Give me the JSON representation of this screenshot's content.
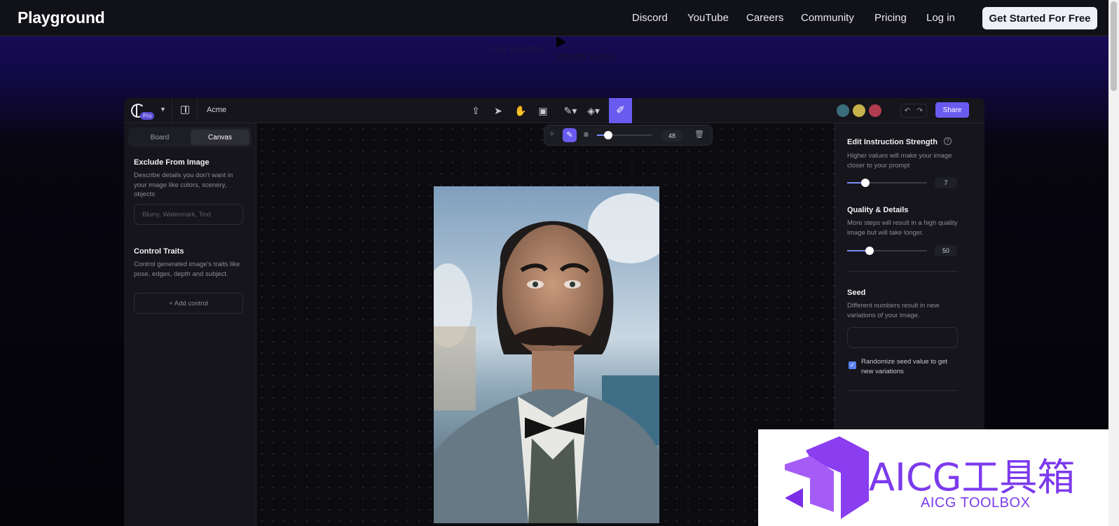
{
  "site": {
    "brand": "Playground",
    "nav": [
      "Discord",
      "YouTube",
      "Careers",
      "Community",
      "Pricing",
      "Log in"
    ],
    "cta": "Get Started For Free"
  },
  "hero": {
    "link_primary": "Get Started",
    "link_secondary": "Watch Video"
  },
  "app": {
    "badge": "Pro",
    "project": "Acme",
    "share": "Share",
    "tabs": [
      "Board",
      "Canvas"
    ],
    "active_tab": "Canvas",
    "brush_size": "48"
  },
  "left_panel": {
    "exclude_title": "Exclude From Image",
    "exclude_desc": "Describe details you don't want in your image like colors, scenery, objects",
    "exclude_placeholder": "Blurry, Watermark, Text",
    "control_title": "Control Traits",
    "control_desc": "Control generated image's traits like pose, edges, depth and subject.",
    "add_control": "+ Add control"
  },
  "right_panel": {
    "strength_title": "Edit Instruction Strength",
    "strength_desc": "Higher values will make your image closer to your prompt",
    "strength_value": "7",
    "quality_title": "Quality & Details",
    "quality_desc": "More steps will result in a high quality image but will take longer.",
    "quality_value": "50",
    "seed_title": "Seed",
    "seed_desc": "Different numbers result in new variations of your image.",
    "randomize_label": "Randomize seed value to get new variations",
    "randomize_checked": true
  },
  "watermark": {
    "title": "AICG工具箱",
    "subtitle": "AICG TOOLBOX"
  },
  "colors": {
    "accent": "#6a5bf0",
    "watermark": "#7c3aed"
  }
}
